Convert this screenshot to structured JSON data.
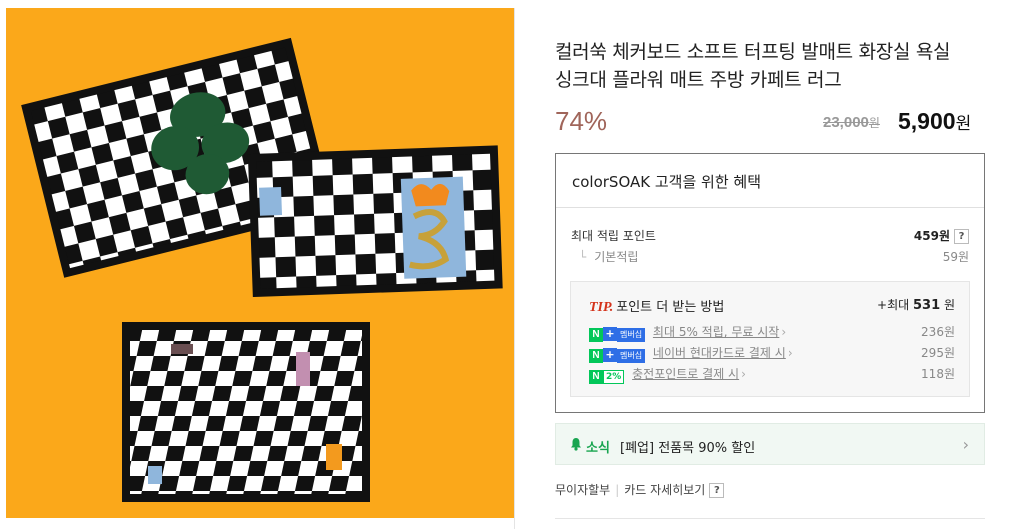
{
  "product": {
    "title_line1": "컬러쑥 체커보드 소프트 터프팅 발매트 화장실 욕실",
    "title_line2": "싱크대 플라워 매트 주방 카페트 러그",
    "discount": "74%",
    "original_price": "23,000",
    "original_unit": "원",
    "sale_price": "5,900",
    "sale_unit": "원",
    "image_alt": "checkered tufted rugs on orange background"
  },
  "benefit": {
    "heading": "colorSOAK 고객을 위한 혜택",
    "max_points_label": "최대 적립 포인트",
    "max_points_value": "459원",
    "help": "?",
    "basic_label": "기본적립",
    "basic_value": "59원",
    "tip": {
      "tip_word": "TIP.",
      "heading": "포인트 더 받는 방법",
      "max_prefix": "+최대",
      "max_value": "531",
      "max_unit": "원",
      "rows": [
        {
          "badge_text": "멤버십",
          "link": "최대 5% 적립, 무료 시작",
          "amount": "236원"
        },
        {
          "badge_text": "멤버십",
          "link": "네이버 현대카드로 결제 시",
          "amount": "295원"
        },
        {
          "badge_text": "2%",
          "link": "충전포인트로 결제 시",
          "amount": "118원"
        }
      ]
    }
  },
  "notice": {
    "label": "소식",
    "text": "[폐업] 전품목 90% 할인"
  },
  "footer": {
    "installment": "무이자할부",
    "card_details": "카드 자세히보기",
    "help": "?"
  },
  "colors": {
    "image_bg": "#fba81a",
    "discount": "#a0655a",
    "naver_green": "#03c75a",
    "membership_blue": "#2e6ee6",
    "tip_red": "#d4331b"
  },
  "icons": [
    "bell-icon",
    "chevron-right-icon",
    "naver-n-icon",
    "plus-icon",
    "question-icon"
  ]
}
